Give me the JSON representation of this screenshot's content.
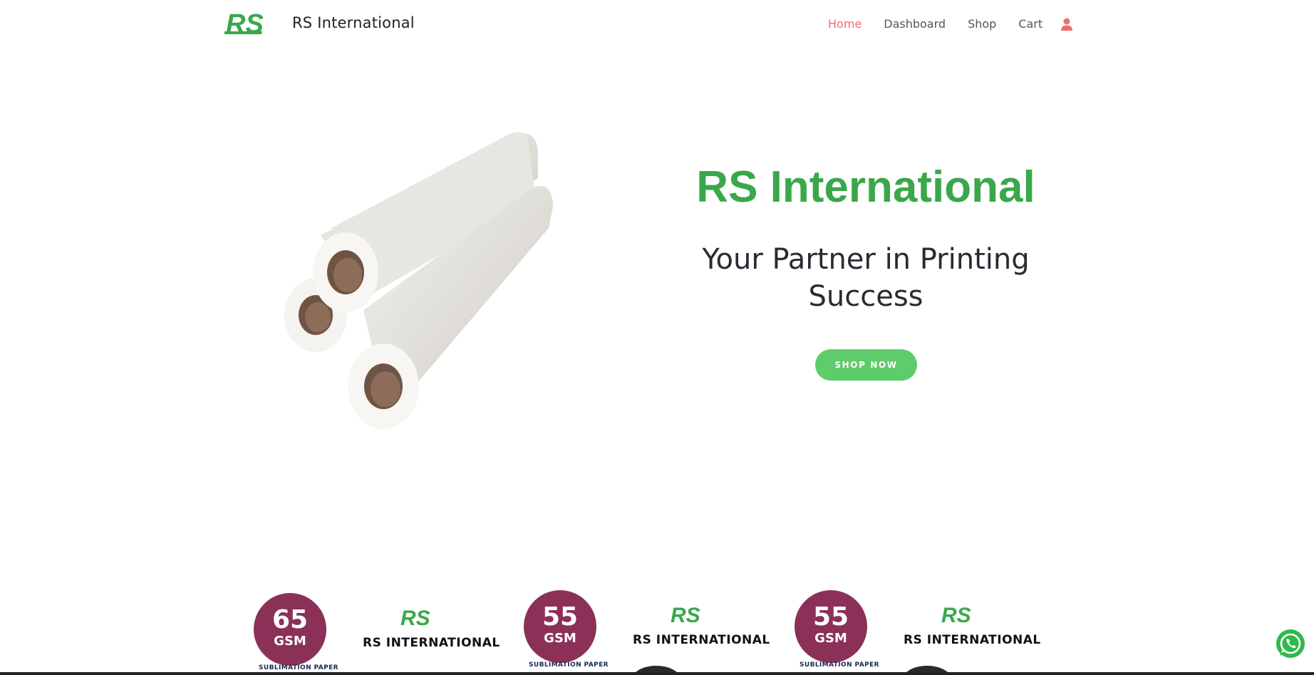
{
  "header": {
    "brand": "RS International",
    "logo_text": "RS",
    "nav": [
      {
        "label": "Home",
        "active": true
      },
      {
        "label": "Dashboard",
        "active": false
      },
      {
        "label": "Shop",
        "active": false
      },
      {
        "label": "Cart",
        "active": false
      }
    ],
    "user_icon": "user-icon"
  },
  "hero": {
    "title": "RS International",
    "subtitle": "Your Partner in Printing Success",
    "cta": "SHOP NOW",
    "image": "paper-rolls-image"
  },
  "products": [
    {
      "gsm": "65",
      "unit": "GSM",
      "type": "SUBLIMATION PAPER",
      "brand": "RS INTERNATIONAL"
    },
    {
      "gsm": "55",
      "unit": "GSM",
      "type": "SUBLIMATION PAPER",
      "brand": "RS INTERNATIONAL"
    },
    {
      "gsm": "55",
      "unit": "GSM",
      "type": "SUBLIMATION PAPER",
      "brand": "RS INTERNATIONAL"
    }
  ],
  "floating": {
    "whatsapp_icon": "whatsapp-icon"
  },
  "colors": {
    "brand_green": "#3aa74a",
    "button_green": "#5fcc6c",
    "nav_active": "#f26d6d",
    "gsm_circle": "#8b3158"
  }
}
